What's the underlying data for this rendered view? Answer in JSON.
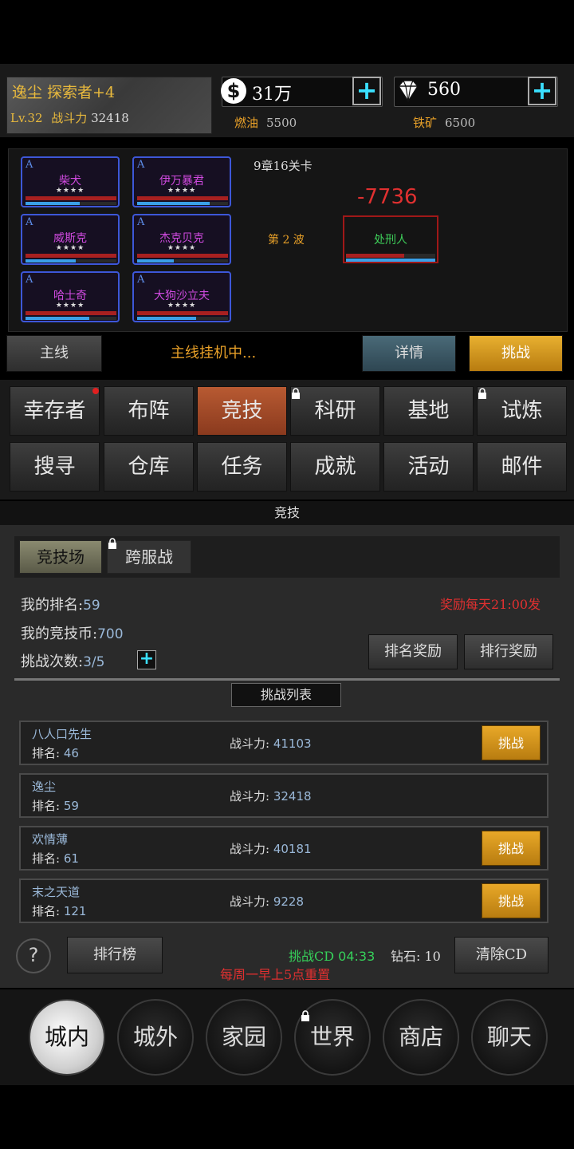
{
  "player": {
    "name_title": "逸尘 探索者+4",
    "level": "Lv.32",
    "power_label": "战斗力",
    "power_value": "32418"
  },
  "resources": {
    "money": "31万",
    "diamonds": "560",
    "fuel_label": "燃油",
    "fuel_value": "5500",
    "ore_label": "铁矿",
    "ore_value": "6500",
    "plus_symbol": "+"
  },
  "battle": {
    "heroes": [
      {
        "grade": "A",
        "name": "柴犬",
        "stars": "★★★★",
        "mp": 0.6
      },
      {
        "grade": "A",
        "name": "伊万暴君",
        "stars": "★★★★",
        "mp": 0.8
      },
      {
        "grade": "A",
        "name": "威斯克",
        "stars": "★★★★",
        "mp": 0.55
      },
      {
        "grade": "A",
        "name": "杰克贝克",
        "stars": "★★★★",
        "mp": 0.4
      },
      {
        "grade": "A",
        "name": "哈士奇",
        "stars": "★★★★",
        "mp": 0.7
      },
      {
        "grade": "A",
        "name": "大狗沙立夫",
        "stars": "★★★★",
        "mp": 0.65
      }
    ],
    "stage": "9章16关卡",
    "wave": "第 2 波",
    "damage": "-7736",
    "boss_name": "处刑人",
    "boss_hp": 0.65
  },
  "actions": {
    "mainline": "主线",
    "idle": "主线挂机中...",
    "detail": "详情",
    "challenge": "挑战"
  },
  "menu": {
    "row1": [
      "幸存者",
      "布阵",
      "竞技",
      "科研",
      "基地",
      "试炼"
    ],
    "row2": [
      "搜寻",
      "仓库",
      "任务",
      "成就",
      "活动",
      "邮件"
    ]
  },
  "section_title": "竞技",
  "arena": {
    "tabs": [
      "竞技场",
      "跨服战"
    ],
    "my_rank_label": "我的排名:",
    "my_rank": "59",
    "my_coins_label": "我的竞技币:",
    "my_coins": "700",
    "attempts_label": "挑战次数:",
    "attempts": "3/5",
    "reward_time": "奖励每天21:00发",
    "rank_reward": "排名奖励",
    "leaderboard_reward": "排行奖励",
    "list_title": "挑战列表",
    "rank_prefix": "排名:",
    "power_prefix": "战斗力:",
    "challenge_btn": "挑战",
    "opponents": [
      {
        "name": "八人口先生",
        "rank": "46",
        "power": "41103",
        "can_challenge": true
      },
      {
        "name": "逸尘",
        "rank": "59",
        "power": "32418",
        "can_challenge": false
      },
      {
        "name": "欢情薄",
        "rank": "61",
        "power": "40181",
        "can_challenge": true
      },
      {
        "name": "末之天道",
        "rank": "121",
        "power": "9228",
        "can_challenge": true
      }
    ],
    "help": "?",
    "leaderboard": "排行榜",
    "cd_label": "挑战CD",
    "cd_time": "04:33",
    "diamond_cost": "钻石: 10",
    "clear_cd": "清除CD",
    "reset_note": "每周一早上5点重置"
  },
  "nav": [
    "城内",
    "城外",
    "家园",
    "世界",
    "商店",
    "聊天"
  ]
}
